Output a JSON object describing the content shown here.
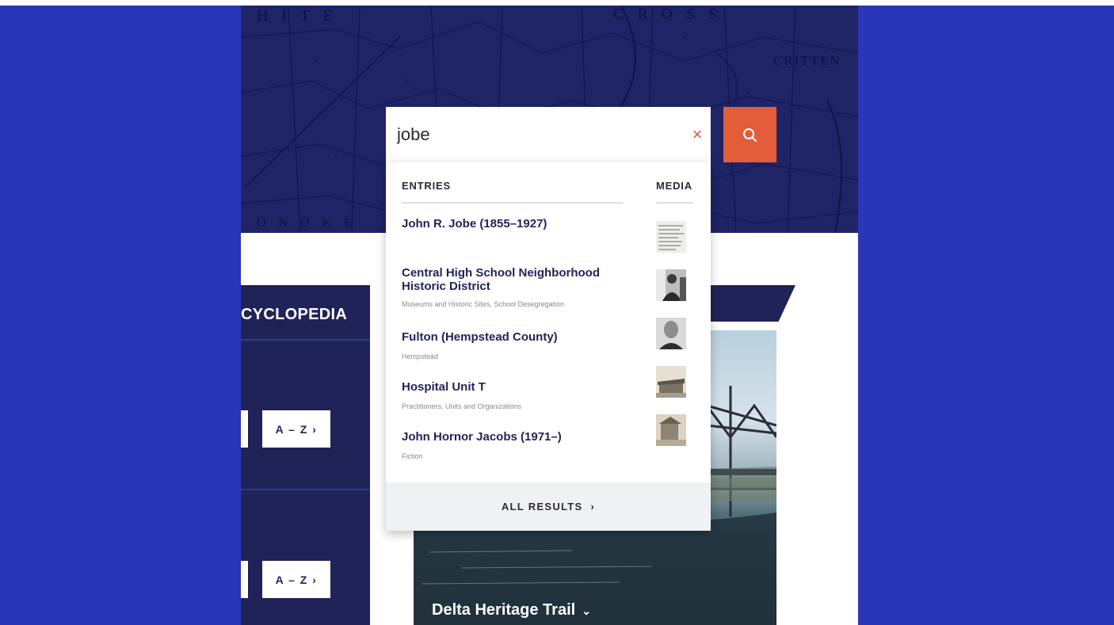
{
  "search": {
    "query": "jobe",
    "clear_icon": "×"
  },
  "dropdown": {
    "entries_header": "ENTRIES",
    "media_header": "MEDIA",
    "results": [
      {
        "title": "John R. Jobe (1855–1927)",
        "subtitle": ""
      },
      {
        "title": "Central High School Neighborhood Historic District",
        "subtitle": "Museums and Historic Sites, School Desegregation"
      },
      {
        "title": "Fulton (Hempstead County)",
        "subtitle": "Hempstead"
      },
      {
        "title": "Hospital Unit T",
        "subtitle": "Practitioners, Units and Organizations"
      },
      {
        "title": "John Hornor Jacobs (1971–)",
        "subtitle": "Fiction"
      }
    ],
    "all_results_label": "ALL RESULTS",
    "all_results_chevron": "›"
  },
  "left_panel": {
    "title": "CYCLOPEDIA",
    "az_label_1": "A – Z  ›",
    "az_label_2": "A – Z  ›"
  },
  "feature": {
    "caption": "Delta Heritage Trail",
    "caption_chevron": "⌄"
  },
  "map": {
    "words": [
      "H  I  T  E",
      "C  R  O  S  S",
      "CRITTEN",
      "O  N  O  K  E"
    ]
  },
  "colors": {
    "page_bg": "#2a36b8",
    "navy": "#1f2358",
    "accent": "#e45d3b",
    "map_tint": "#1e2466"
  },
  "icons": {
    "search": "search-icon",
    "clear": "close-icon",
    "chevron_right": "chevron-right-icon",
    "chevron_down": "chevron-down-icon"
  }
}
